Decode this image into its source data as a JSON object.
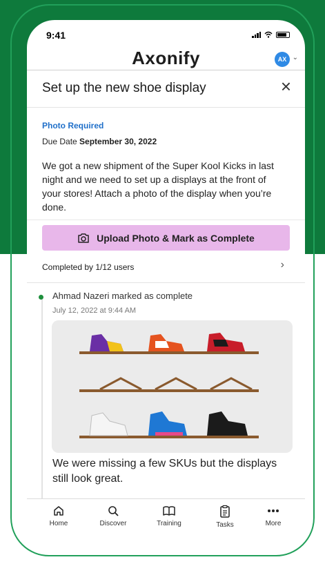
{
  "status_bar": {
    "time": "9:41"
  },
  "app": {
    "logo": "Axonify",
    "avatar_initials": "AX"
  },
  "task": {
    "title": "Set up the new shoe display",
    "photo_required": "Photo Required",
    "due_label": "Due Date",
    "due_date": "September 30, 2022",
    "description": "We got a new shipment of the Super Kool Kicks in last night and we need to set up a displays at the front of your stores! Attach a photo of the display when you’re done.",
    "upload_button": "Upload Photo & Mark as Complete",
    "completed_by": "Completed by 1/12 users"
  },
  "feed": {
    "name": "Ahmad Nazeri marked as complete",
    "date": "July 12, 2022 at 9:44 AM",
    "caption": "We were missing a few SKUs but the displays still look great."
  },
  "tabs": [
    {
      "label": "Home",
      "icon": "home-icon"
    },
    {
      "label": "Discover",
      "icon": "search-icon"
    },
    {
      "label": "Training",
      "icon": "book-icon"
    },
    {
      "label": "Tasks",
      "icon": "clipboard-icon"
    },
    {
      "label": "More",
      "icon": "more-dots-icon"
    }
  ],
  "colors": {
    "brand_green": "#0e7a3c",
    "button_pink": "#e8b7ea",
    "link_blue": "#1f6fc9",
    "avatar_blue": "#2f8ae5"
  }
}
